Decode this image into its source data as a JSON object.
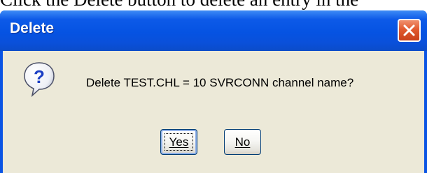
{
  "background_text": "Click the Delete button to delete an entry in the",
  "dialog": {
    "title": "Delete",
    "message": "Delete TEST.CHL = 10 SVRCONN channel name?",
    "icon": "question-icon",
    "close_icon": "close-icon",
    "buttons": {
      "yes": "Yes",
      "no": "No"
    },
    "colors": {
      "titlebar": "#0553e2",
      "client": "#ece9d8",
      "close": "#e15a2f"
    }
  }
}
